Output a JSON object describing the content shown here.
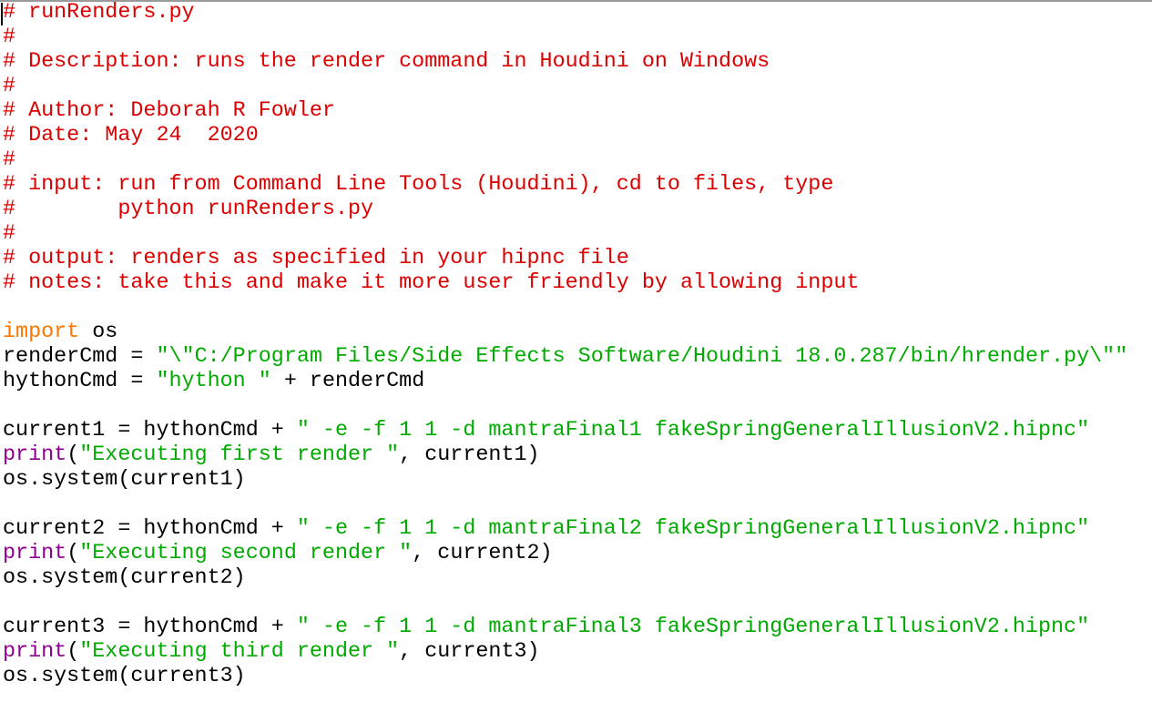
{
  "editor": {
    "language": "python",
    "colors": {
      "comment": "#dd0000",
      "keyword": "#ff7700",
      "string": "#00aa00",
      "builtin": "#900090",
      "default": "#000000"
    },
    "lines": [
      [
        {
          "t": "cmt",
          "v": "# runRenders.py"
        }
      ],
      [
        {
          "t": "cmt",
          "v": "#"
        }
      ],
      [
        {
          "t": "cmt",
          "v": "# Description: runs the render command in Houdini on Windows"
        }
      ],
      [
        {
          "t": "cmt",
          "v": "#"
        }
      ],
      [
        {
          "t": "cmt",
          "v": "# Author: Deborah R Fowler"
        }
      ],
      [
        {
          "t": "cmt",
          "v": "# Date: May 24  2020"
        }
      ],
      [
        {
          "t": "cmt",
          "v": "#"
        }
      ],
      [
        {
          "t": "cmt",
          "v": "# input: run from Command Line Tools (Houdini), cd to files, type"
        }
      ],
      [
        {
          "t": "cmt",
          "v": "#        python runRenders.py"
        }
      ],
      [
        {
          "t": "cmt",
          "v": "#"
        }
      ],
      [
        {
          "t": "cmt",
          "v": "# output: renders as specified in your hipnc file"
        }
      ],
      [
        {
          "t": "cmt",
          "v": "# notes: take this and make it more user friendly by allowing input"
        }
      ],
      [],
      [
        {
          "t": "kw",
          "v": "import"
        },
        {
          "t": "plain",
          "v": " os"
        }
      ],
      [
        {
          "t": "plain",
          "v": "renderCmd = "
        },
        {
          "t": "str",
          "v": "\"\\\"C:/Program Files/Side Effects Software/Houdini 18.0.287/bin/hrender.py\\\"\""
        }
      ],
      [
        {
          "t": "plain",
          "v": "hythonCmd = "
        },
        {
          "t": "str",
          "v": "\"hython \""
        },
        {
          "t": "plain",
          "v": " + renderCmd"
        }
      ],
      [],
      [
        {
          "t": "plain",
          "v": "current1 = hythonCmd + "
        },
        {
          "t": "str",
          "v": "\" -e -f 1 1 -d mantraFinal1 fakeSpringGeneralIllusionV2.hipnc\""
        }
      ],
      [
        {
          "t": "bi",
          "v": "print"
        },
        {
          "t": "plain",
          "v": "("
        },
        {
          "t": "str",
          "v": "\"Executing first render \""
        },
        {
          "t": "plain",
          "v": ", current1)"
        }
      ],
      [
        {
          "t": "plain",
          "v": "os.system(current1)"
        }
      ],
      [],
      [
        {
          "t": "plain",
          "v": "current2 = hythonCmd + "
        },
        {
          "t": "str",
          "v": "\" -e -f 1 1 -d mantraFinal2 fakeSpringGeneralIllusionV2.hipnc\""
        }
      ],
      [
        {
          "t": "bi",
          "v": "print"
        },
        {
          "t": "plain",
          "v": "("
        },
        {
          "t": "str",
          "v": "\"Executing second render \""
        },
        {
          "t": "plain",
          "v": ", current2)"
        }
      ],
      [
        {
          "t": "plain",
          "v": "os.system(current2)"
        }
      ],
      [],
      [
        {
          "t": "plain",
          "v": "current3 = hythonCmd + "
        },
        {
          "t": "str",
          "v": "\" -e -f 1 1 -d mantraFinal3 fakeSpringGeneralIllusionV2.hipnc\""
        }
      ],
      [
        {
          "t": "bi",
          "v": "print"
        },
        {
          "t": "plain",
          "v": "("
        },
        {
          "t": "str",
          "v": "\"Executing third render \""
        },
        {
          "t": "plain",
          "v": ", current3)"
        }
      ],
      [
        {
          "t": "plain",
          "v": "os.system(current3)"
        }
      ]
    ]
  }
}
